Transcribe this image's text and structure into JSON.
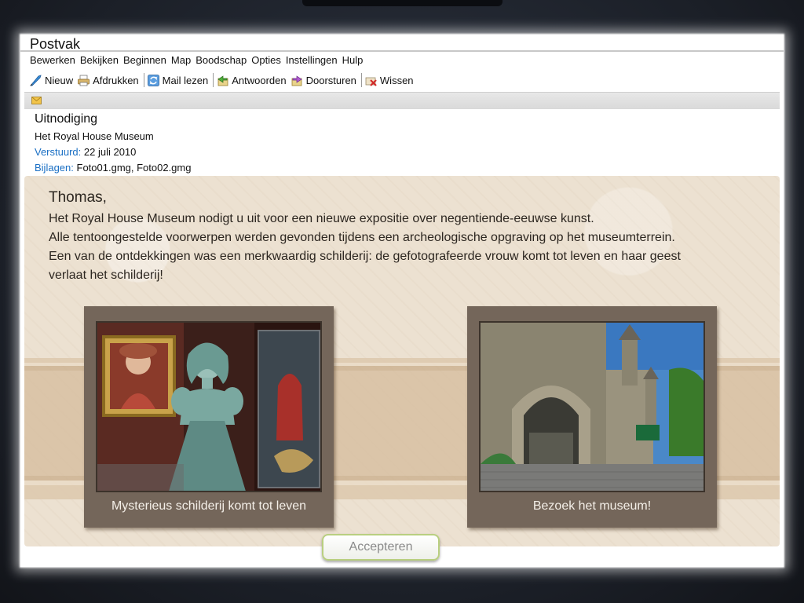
{
  "window": {
    "title": "Postvak"
  },
  "menu": {
    "items": [
      {
        "label": "Bewerken"
      },
      {
        "label": "Bekijken"
      },
      {
        "label": "Beginnen"
      },
      {
        "label": "Map"
      },
      {
        "label": "Boodschap"
      },
      {
        "label": "Opties"
      },
      {
        "label": "Instellingen"
      },
      {
        "label": "Hulp"
      }
    ]
  },
  "toolbar": {
    "new_label": "Nieuw",
    "print_label": "Afdrukken",
    "read_label": "Mail lezen",
    "reply_label": "Antwoorden",
    "forward_label": "Doorsturen",
    "delete_label": "Wissen"
  },
  "message": {
    "subject": "Uitnodiging",
    "sender": "Het Royal House Museum",
    "sent_label": "Verstuurd:",
    "sent_date": "22 juli 2010",
    "attachments_label": "Bijlagen:",
    "attachments": "Foto01.gmg, Foto02.gmg",
    "salutation": "Thomas,",
    "body": [
      "Het Royal House Museum nodigt u uit voor een nieuwe expositie over negentiende-eeuwse kunst.",
      "Alle tentoongestelde voorwerpen werden gevonden tijdens een archeologische opgraving op het museumterrein.",
      "Een van de ontdekkingen was een merkwaardig schilderij: de gefotografeerde vrouw komt tot leven en haar geest",
      "verlaat het schilderij!"
    ]
  },
  "cards": [
    {
      "caption": "Mysterieus schilderij komt tot leven"
    },
    {
      "caption": "Bezoek het museum!"
    }
  ],
  "accept_label": "Accepteren"
}
